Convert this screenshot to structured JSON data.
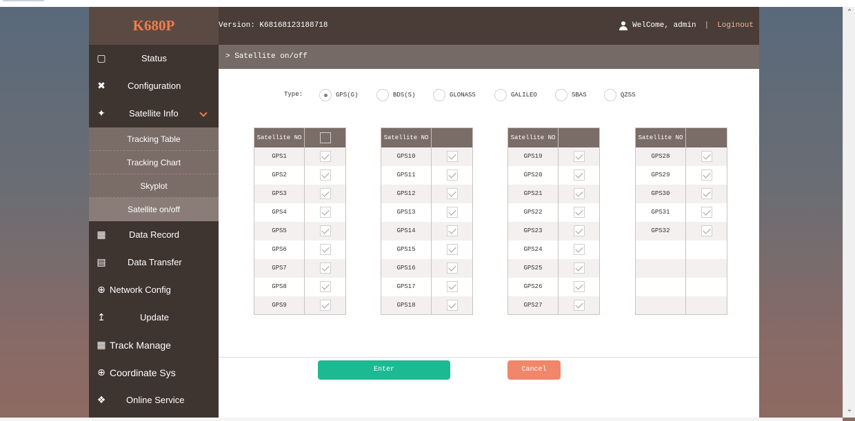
{
  "header": {
    "logo": "K680P",
    "version": "Version: K68168123188718",
    "welcome": "WelCome, admin",
    "separator": "|",
    "logout": "Loginout"
  },
  "sidebar": {
    "items": [
      {
        "label": "Status",
        "icon": "monitor-icon"
      },
      {
        "label": "Configuration",
        "icon": "tools-icon"
      },
      {
        "label": "Satellite Info",
        "icon": "satellite-icon"
      },
      {
        "label": "Data Record",
        "icon": "calendar-icon"
      },
      {
        "label": "Data Transfer",
        "icon": "network-icon"
      },
      {
        "label": "Network Config",
        "icon": "globe-icon"
      },
      {
        "label": "Update",
        "icon": "upload-icon"
      },
      {
        "label": "Track Manage",
        "icon": "calendar-icon"
      },
      {
        "label": "Coordinate Sys",
        "icon": "globe-icon"
      },
      {
        "label": "Online Service",
        "icon": "service-icon"
      }
    ],
    "sub_items": [
      "Tracking Table",
      "Tracking Chart",
      "Skyplot",
      "Satellite on/off"
    ]
  },
  "main": {
    "breadcrumb": "> Satellite on/off",
    "type_label": "Type:",
    "types": [
      "GPS(G)",
      "BDS(S)",
      "GLONASS",
      "GALILEO",
      "SBAS",
      "QZSS"
    ],
    "selected_type": "GPS(G)",
    "column_header": "Satellite NO",
    "tables": [
      [
        "GPS1",
        "GPS2",
        "GPS3",
        "GPS4",
        "GPS5",
        "GPS6",
        "GPS7",
        "GPS8",
        "GPS9"
      ],
      [
        "GPS10",
        "GPS11",
        "GPS12",
        "GPS13",
        "GPS14",
        "GPS15",
        "GPS16",
        "GPS17",
        "GPS18"
      ],
      [
        "GPS19",
        "GPS20",
        "GPS21",
        "GPS22",
        "GPS23",
        "GPS24",
        "GPS25",
        "GPS26",
        "GPS27"
      ],
      [
        "GPS28",
        "GPS29",
        "GPS30",
        "GPS31",
        "GPS32",
        "",
        "",
        "",
        ""
      ]
    ],
    "enter_label": "Enter",
    "cancel_label": "Cancel"
  },
  "colors": {
    "accent": "#f07e4c",
    "enter": "#1cb992",
    "cancel": "#f0866a",
    "header": "#4a3d37",
    "sidebar": "#3e3430"
  }
}
